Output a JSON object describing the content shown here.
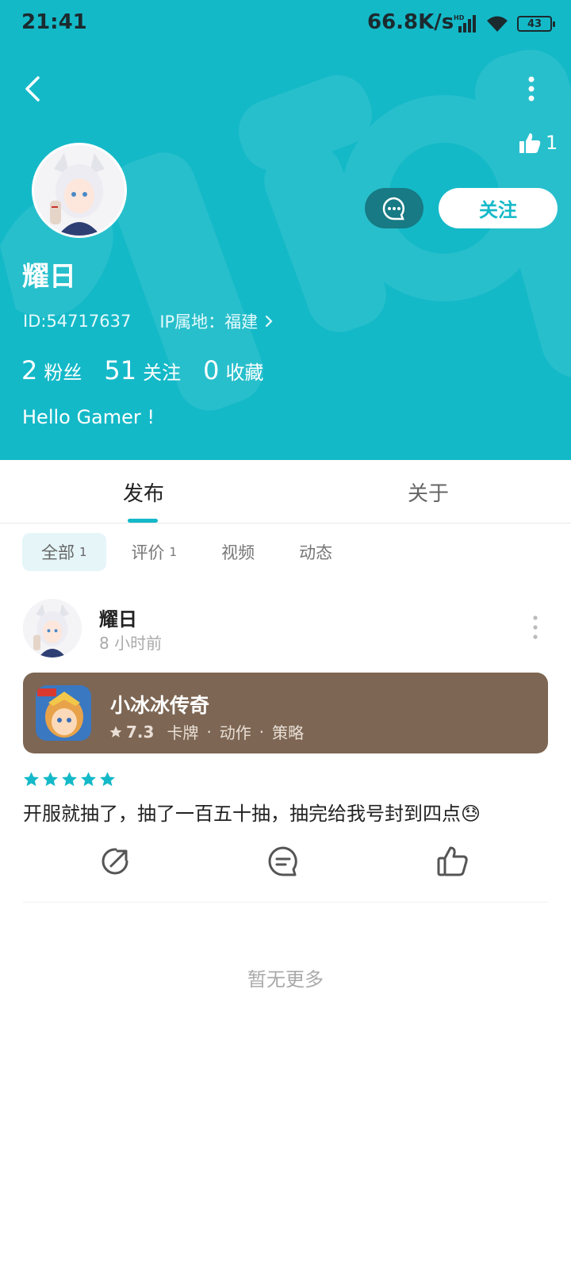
{
  "statusbar": {
    "time": "21:41",
    "speed": "66.8K/s",
    "network_badge": "HD",
    "battery": "43"
  },
  "profile": {
    "username": "耀日",
    "id_text": "ID:54717637",
    "ip_text": "IP属地：福建",
    "likes": "1",
    "follow_label": "关注",
    "bio": "Hello Gamer !",
    "stats": [
      {
        "num": "2",
        "label": "粉丝"
      },
      {
        "num": "51",
        "label": "关注"
      },
      {
        "num": "0",
        "label": "收藏"
      }
    ]
  },
  "tabs": {
    "post": "发布",
    "about": "关于"
  },
  "filters": {
    "all": "全部",
    "all_count": "1",
    "review": "评价",
    "review_count": "1",
    "video": "视频",
    "moment": "动态"
  },
  "post": {
    "user": "耀日",
    "time": "8 小时前",
    "rating_stars": 5,
    "text": "开服就抽了，抽了一百五十抽，抽完给我号封到四点😓",
    "game": {
      "name": "小冰冰传奇",
      "score": "7.3",
      "tags": [
        "卡牌",
        "动作",
        "策略"
      ]
    }
  },
  "footer": {
    "no_more": "暂无更多"
  },
  "colors": {
    "accent": "#14b9c8",
    "card_bg": "#7d6653"
  },
  "icons": [
    "back-icon",
    "more-vertical-icon",
    "thumb-up-icon",
    "chat-bubble-icon",
    "share-icon",
    "comment-icon",
    "like-icon",
    "star-icon",
    "chevron-right-icon",
    "wifi-icon",
    "signal-icon",
    "battery-icon"
  ]
}
